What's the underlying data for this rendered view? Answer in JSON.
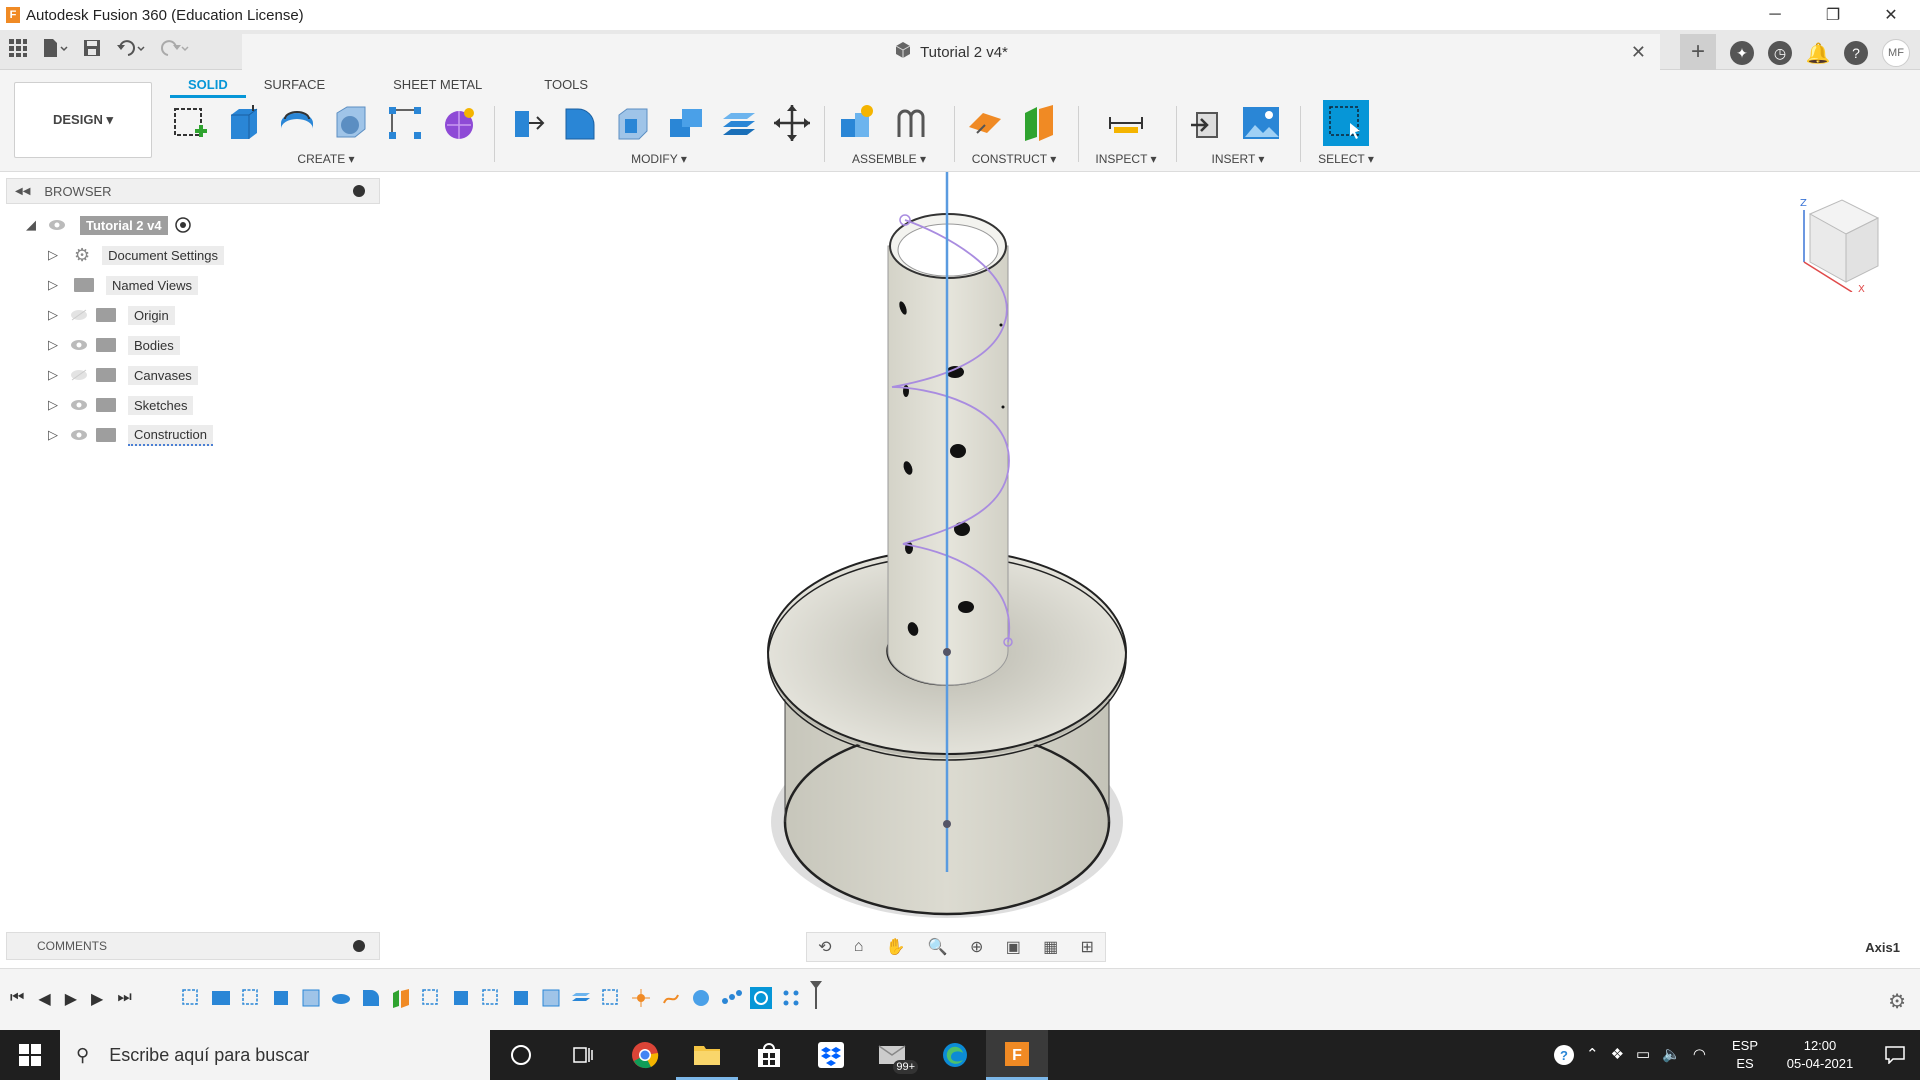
{
  "window": {
    "title": "Autodesk Fusion 360 (Education License)",
    "logo_letter": "F"
  },
  "document": {
    "tab_title": "Tutorial 2 v4*",
    "close_glyph": "✕"
  },
  "user": {
    "initials": "MF"
  },
  "workspace": {
    "label": "DESIGN ▾"
  },
  "tabs": [
    {
      "label": "SOLID"
    },
    {
      "label": "SURFACE"
    },
    {
      "label": "SHEET METAL"
    },
    {
      "label": "TOOLS"
    }
  ],
  "tool_groups": {
    "create": "CREATE ▾",
    "modify": "MODIFY ▾",
    "assemble": "ASSEMBLE ▾",
    "construct": "CONSTRUCT ▾",
    "inspect": "INSPECT ▾",
    "insert": "INSERT ▾",
    "select": "SELECT ▾"
  },
  "browser": {
    "label": "BROWSER",
    "items": [
      {
        "label": "Tutorial 2 v4"
      },
      {
        "label": "Document Settings"
      },
      {
        "label": "Named Views"
      },
      {
        "label": "Origin"
      },
      {
        "label": "Bodies"
      },
      {
        "label": "Canvases"
      },
      {
        "label": "Sketches"
      },
      {
        "label": "Construction"
      }
    ]
  },
  "comments": {
    "label": "COMMENTS"
  },
  "viewport": {
    "selection_label": "Axis1"
  },
  "taskbar": {
    "search_placeholder": "Escribe aquí para buscar",
    "mail_badge": "99+",
    "lang_top": "ESP",
    "lang_bottom": "ES",
    "time": "12:00",
    "date": "05-04-2021"
  },
  "colors": {
    "accent": "#0696d7",
    "fusion_orange": "#f08a24",
    "taskbar_bg": "#1f1f1f",
    "model_body": "#d9d8cc",
    "sketch_curve": "#a98ce0"
  }
}
